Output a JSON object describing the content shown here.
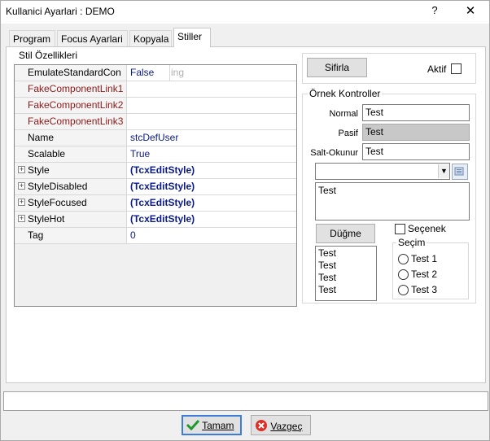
{
  "window": {
    "title": "Kullanici Ayarlari : DEMO",
    "help": "?",
    "close": "✕"
  },
  "tabs": [
    "Program",
    "Focus Ayarlari",
    "Kopyala",
    "Stiller"
  ],
  "stil": {
    "group_label": "Stil Özellikleri",
    "rows": [
      {
        "name": "EmulateStandardCon",
        "value": "False",
        "ghost": "ing"
      },
      {
        "name": "FakeComponentLink1",
        "value": ""
      },
      {
        "name": "FakeComponentLink2",
        "value": ""
      },
      {
        "name": "FakeComponentLink3",
        "value": ""
      },
      {
        "name": "Name",
        "value": "stcDefUser"
      },
      {
        "name": "Scalable",
        "value": "True"
      },
      {
        "name": "Style",
        "value": "(TcxEditStyle)"
      },
      {
        "name": "StyleDisabled",
        "value": "(TcxEditStyle)"
      },
      {
        "name": "StyleFocused",
        "value": "(TcxEditStyle)"
      },
      {
        "name": "StyleHot",
        "value": "(TcxEditStyle)"
      },
      {
        "name": "Tag",
        "value": "0"
      }
    ]
  },
  "right": {
    "reset_label": "Sifirla",
    "active_label": "Aktif",
    "ornek_label": "Örnek Kontroller",
    "normal_label": "Normal",
    "normal_value": "Test",
    "pasif_label": "Pasif",
    "pasif_value": "Test",
    "salt_label": "Salt-Okunur",
    "salt_value": "Test",
    "combo_value": "",
    "memo_value": "Test",
    "button_label": "Düğme",
    "checkbox_label": "Seçenek",
    "list_items": [
      "Test",
      "Test",
      "Test",
      "Test"
    ],
    "radio_group_label": "Seçim",
    "radios": [
      "Test 1",
      "Test 2",
      "Test 3"
    ]
  },
  "footer": {
    "ok_label": "Tamam",
    "cancel_label": "Vazgeç"
  }
}
